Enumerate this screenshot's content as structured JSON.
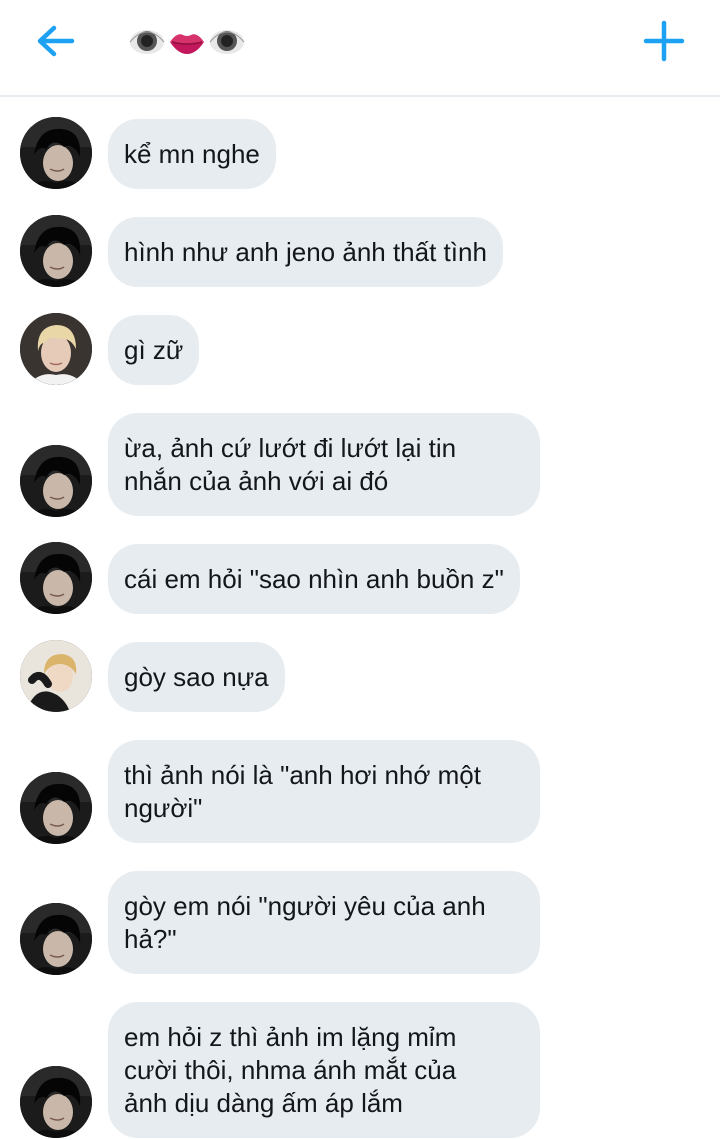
{
  "header": {
    "title_emoji": [
      "eye-icon",
      "lips-icon",
      "eye-icon"
    ],
    "back_icon": "arrow-left-icon",
    "new_icon": "plus-icon",
    "accent_color": "#1da1f2"
  },
  "conversation": {
    "bubble_color": "#e6ecf0",
    "messages": [
      {
        "sender": "dark-hair-user",
        "text": "kể mn nghe"
      },
      {
        "sender": "dark-hair-user",
        "text": "hình như anh jeno ảnh thất tình"
      },
      {
        "sender": "blond-user",
        "text": "gì zữ"
      },
      {
        "sender": "dark-hair-user",
        "text": "ừa, ảnh cứ lướt đi lướt lại tin\nnhắn của ảnh với ai đó"
      },
      {
        "sender": "dark-hair-user",
        "text": "cái em hỏi \"sao nhìn anh buồn z\""
      },
      {
        "sender": "light-user",
        "text": "gòy sao nựa"
      },
      {
        "sender": "dark-hair-user",
        "text": "thì ảnh nói là \"anh hơi nhớ một\nngười\""
      },
      {
        "sender": "dark-hair-user",
        "text": "gòy em nói \"người yêu của anh\nhả?\""
      },
      {
        "sender": "dark-hair-user",
        "text": "em hỏi z thì ảnh im lặng mỉm\ncười thôi, nhma ánh mắt của\nảnh dịu dàng ấm áp lắm"
      }
    ]
  }
}
